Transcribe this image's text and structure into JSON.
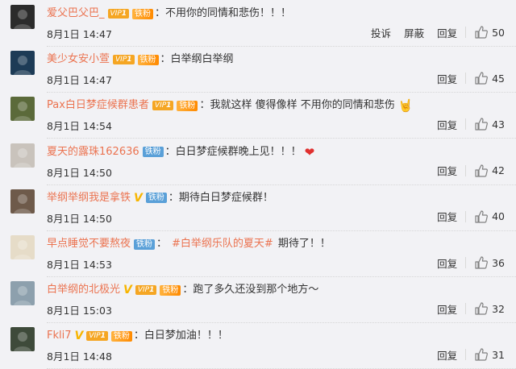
{
  "actions": {
    "report": "投诉",
    "block": "屏蔽",
    "reply": "回复"
  },
  "comments": [
    {
      "username": "爱父巴父巴_",
      "vip_level": "1",
      "fan_badge": "铁粉",
      "fan_style": "gold",
      "verified": false,
      "colon": "：",
      "text": "不用你的同情和悲伤！！！",
      "hashtag": "",
      "text_after": "",
      "emoji": "",
      "time": "8月1日 14:47",
      "likes": "50",
      "show_report": true,
      "avatar_color": "#2b2b2b"
    },
    {
      "username": "美少女安小萱",
      "vip_level": "1",
      "fan_badge": "铁粉",
      "fan_style": "gold",
      "verified": false,
      "colon": "：",
      "text": "白举纲白举纲",
      "hashtag": "",
      "text_after": "",
      "emoji": "",
      "time": "8月1日 14:47",
      "likes": "45",
      "show_report": false,
      "avatar_color": "#1d3b56"
    },
    {
      "username": "Pax白日梦症候群患者",
      "vip_level": "1",
      "fan_badge": "铁粉",
      "fan_style": "gold",
      "verified": false,
      "colon": "：",
      "text": "我就这样  傻得像样 不用你的同情和悲伤",
      "hashtag": "",
      "text_after": "",
      "emoji": "rock",
      "time": "8月1日 14:54",
      "likes": "43",
      "show_report": false,
      "avatar_color": "#5b6a3a"
    },
    {
      "username": "夏天的露珠162636",
      "vip_level": "",
      "fan_badge": "铁粉",
      "fan_style": "iron",
      "verified": false,
      "colon": "：",
      "text": "白日梦症候群晚上见！！！",
      "hashtag": "",
      "text_after": "",
      "emoji": "heart",
      "time": "8月1日 14:50",
      "likes": "42",
      "show_report": false,
      "avatar_color": "#c9c3bc"
    },
    {
      "username": "举纲举纲我是拿铁",
      "vip_level": "",
      "fan_badge": "铁粉",
      "fan_style": "iron",
      "verified": true,
      "colon": "：",
      "text": "期待白日梦症候群！",
      "hashtag": "",
      "text_after": "",
      "emoji": "",
      "time": "8月1日 14:50",
      "likes": "40",
      "show_report": false,
      "avatar_color": "#6e5a4a"
    },
    {
      "username": "早点睡觉不要熬夜",
      "vip_level": "",
      "fan_badge": "铁粉",
      "fan_style": "iron",
      "verified": false,
      "colon": "：",
      "text": "",
      "hashtag": "#白举纲乐队的夏天#",
      "text_after": "期待了！！",
      "emoji": "",
      "time": "8月1日 14:53",
      "likes": "36",
      "show_report": false,
      "avatar_color": "#e6dcc8"
    },
    {
      "username": "白举纲的北极光",
      "vip_level": "1",
      "fan_badge": "铁粉",
      "fan_style": "gold",
      "verified": true,
      "colon": "：",
      "text": "跑了多久还没到那个地方～",
      "hashtag": "",
      "text_after": "",
      "emoji": "",
      "time": "8月1日 15:03",
      "likes": "32",
      "show_report": false,
      "avatar_color": "#8da0ad"
    },
    {
      "username": "Fkli7",
      "vip_level": "1",
      "fan_badge": "铁粉",
      "fan_style": "gold",
      "verified": true,
      "colon": "：",
      "text": "白日梦加油！！！",
      "hashtag": "",
      "text_after": "",
      "emoji": "",
      "time": "8月1日 14:48",
      "likes": "31",
      "show_report": false,
      "avatar_color": "#3e4a3a"
    }
  ]
}
